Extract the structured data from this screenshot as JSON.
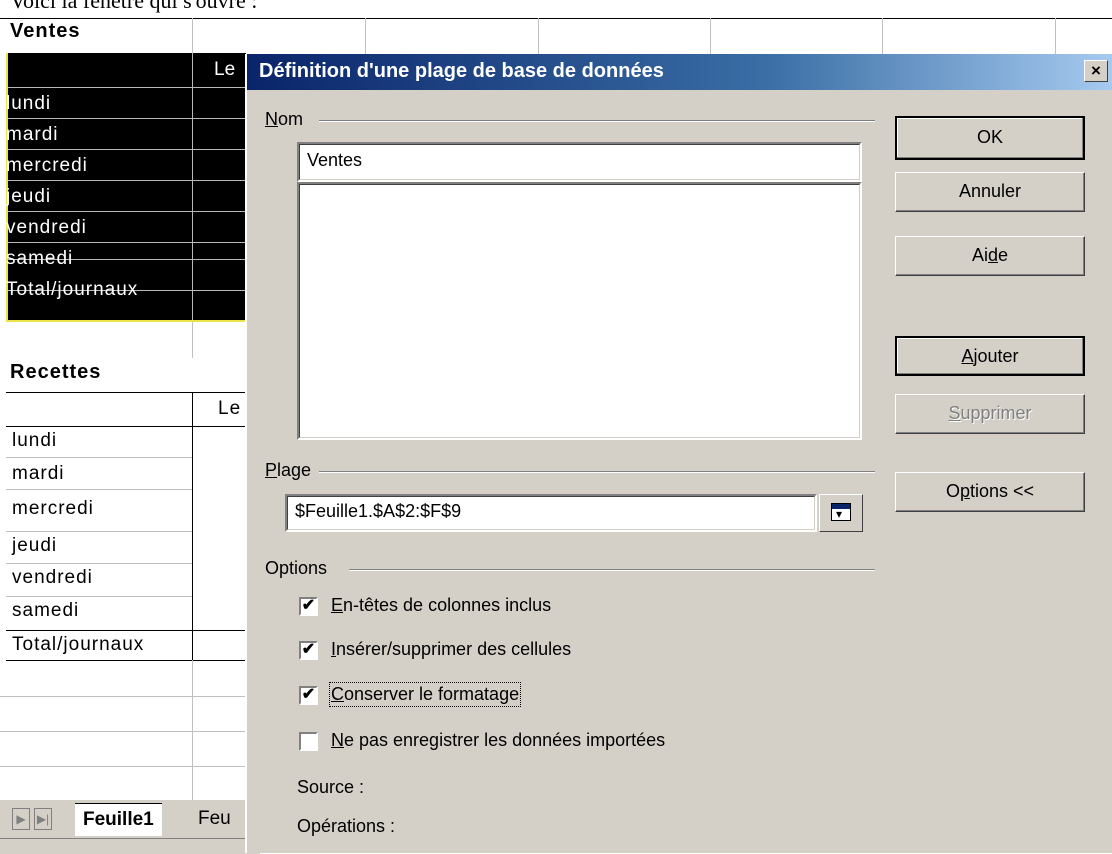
{
  "caption": "Voici la fenêtre qui s'ouvre :",
  "sheet": {
    "table1_title": "Ventes",
    "table1_col_header_partial": "Le",
    "table1_rows": [
      "lundi",
      "mardi",
      "mercredi",
      "jeudi",
      "vendredi",
      "samedi",
      "Total/journaux"
    ],
    "table2_title": "Recettes",
    "table2_col_header_partial": "Le",
    "table2_rows": [
      "lundi",
      "mardi",
      "mercredi",
      "jeudi",
      "vendredi",
      "samedi",
      "Total/journaux"
    ],
    "tabs": {
      "active": "Feuille1",
      "other_partial": "Feu"
    }
  },
  "dialog": {
    "title": "Définition d'une plage de base de données",
    "close_glyph": "×",
    "name_group": {
      "prefix": "",
      "underlined": "N",
      "rest": "om"
    },
    "name_value": "Ventes",
    "range_group": {
      "prefix": "",
      "underlined": "P",
      "rest": "lage"
    },
    "range_value": "$Feuille1.$A$2:$F$9",
    "options_group": "Options",
    "buttons": {
      "ok": "OK",
      "cancel": "Annuler",
      "help": {
        "prefix": "Ai",
        "underlined": "d",
        "rest": "e"
      },
      "add": {
        "prefix": "",
        "underlined": "A",
        "rest": "jouter"
      },
      "delete": {
        "prefix": "",
        "underlined": "S",
        "rest": "upprimer"
      },
      "options": {
        "prefix": "O",
        "underlined": "p",
        "rest": "tions <<"
      }
    },
    "checkboxes": [
      {
        "prefix": "",
        "underlined": "E",
        "rest": "n-têtes de colonnes inclus",
        "checked": true
      },
      {
        "prefix": "",
        "underlined": "I",
        "rest": "nsérer/supprimer des cellules",
        "checked": true
      },
      {
        "prefix": "",
        "underlined": "C",
        "rest": "onserver le formatage",
        "checked": true
      },
      {
        "prefix": "",
        "underlined": "N",
        "rest": "e pas enregistrer les données importées",
        "checked": false
      }
    ],
    "check_glyph": "✔",
    "source_label": "Source :",
    "operations_label": "Opérations :"
  }
}
